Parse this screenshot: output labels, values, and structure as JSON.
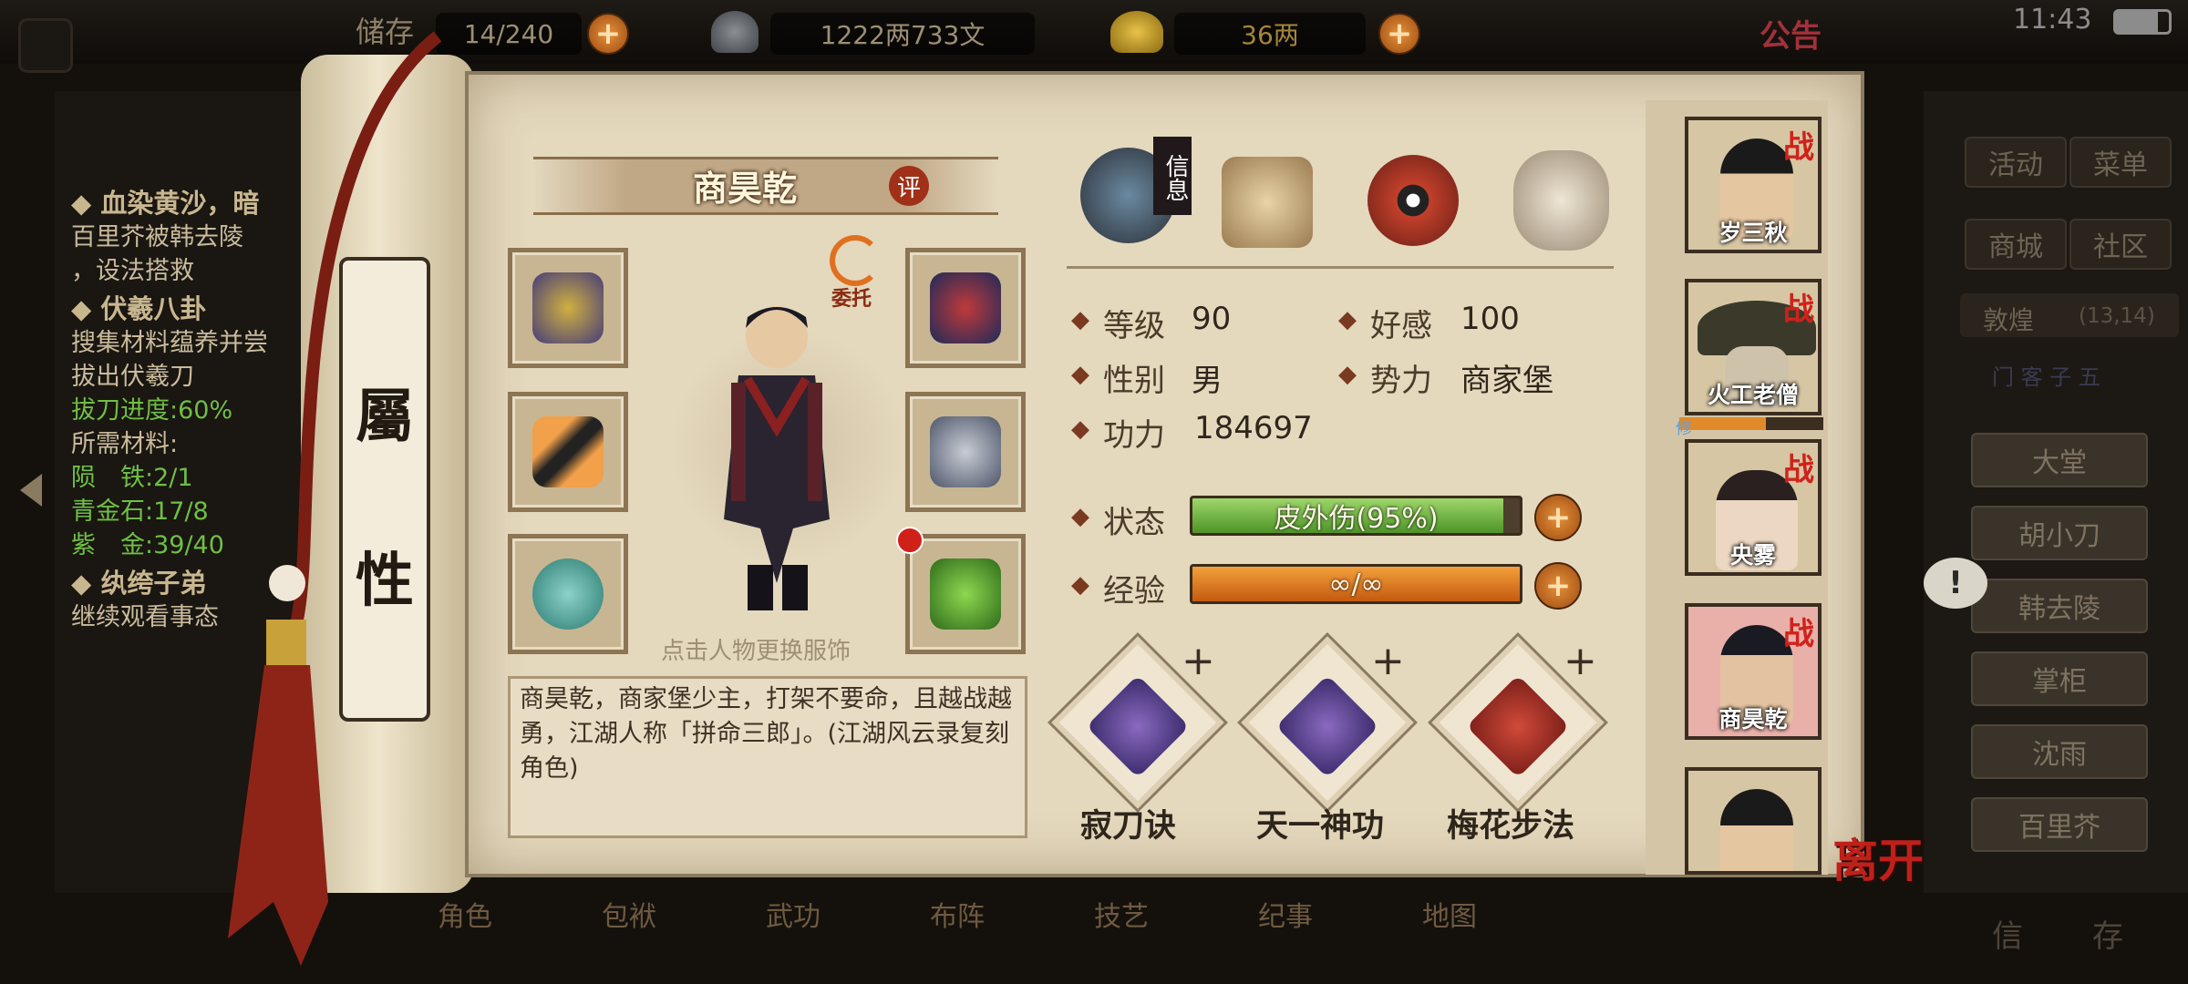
{
  "topbar": {
    "storage_label": "储存",
    "storage_value": "14/240",
    "money_value": "1222两733文",
    "gold_value": "36两",
    "announcement": "公告",
    "time": "11:43"
  },
  "quests": [
    {
      "title": "◆ 血染黄沙，暗",
      "lines": [
        "百里芥被韩去陵",
        "，设法搭救"
      ]
    },
    {
      "title": "◆ 伏羲八卦",
      "lines": [
        "搜集材料蕴养并尝",
        "拔出伏羲刀"
      ],
      "progress": "拔刀进度:60%",
      "req_label": "所需材料:",
      "materials": [
        "陨　铁:2/1",
        "青金石:17/8",
        "紫　金:39/40"
      ]
    },
    {
      "title": "◆ 纨绔子弟",
      "lines": [
        "继续观看事态"
      ]
    }
  ],
  "scroll_tab": {
    "char1": "屬",
    "char2": "性"
  },
  "character": {
    "name": "商昊乾",
    "rate_badge": "评",
    "delegate_label": "委托",
    "hint": "点击人物更换服饰",
    "description": "商昊乾，商家堡少主，打架不要命，且越战越勇，江湖人称「拼命三郎」。(江湖风云录复刻角色)"
  },
  "info_tab_label": "信息",
  "stats": {
    "level_label": "等级",
    "level_value": "90",
    "affinity_label": "好感",
    "affinity_value": "100",
    "gender_label": "性别",
    "gender_value": "男",
    "faction_label": "势力",
    "faction_value": "商家堡",
    "power_label": "功力",
    "power_value": "184697",
    "status_label": "状态",
    "status_text": "皮外伤(95%)",
    "status_fraction": 0.95,
    "exp_label": "经验",
    "exp_text": "∞/∞",
    "exp_fraction": 1.0
  },
  "skills": [
    {
      "name": "寂刀诀"
    },
    {
      "name": "天一神功"
    },
    {
      "name": "梅花步法"
    }
  ],
  "party": [
    {
      "name": "岁三秋",
      "badge": "战"
    },
    {
      "name": "火工老僧",
      "badge": "战",
      "sub": "修"
    },
    {
      "name": "央雾",
      "badge": "战"
    },
    {
      "name": "商昊乾",
      "badge": "战"
    },
    {
      "name": "",
      "badge": ""
    }
  ],
  "right_menu": {
    "activity": "活动",
    "menu": "菜单",
    "shop": "商城",
    "community": "社区",
    "location": "敦煌",
    "coords": "(13,14)",
    "npc_header": "门 客 子 五",
    "npcs": [
      "大堂",
      "胡小刀",
      "韩去陵",
      "掌柜",
      "沈雨",
      "百里芥"
    ],
    "letter": "信",
    "save": "存"
  },
  "leave_label": "离开",
  "bottom_tabs": [
    "角色",
    "包袱",
    "武功",
    "布阵",
    "技艺",
    "纪事",
    "地图"
  ],
  "colors": {
    "status_green": "#6fae3a",
    "exp_orange": "#e07a1e",
    "war_red": "#d0221b"
  }
}
